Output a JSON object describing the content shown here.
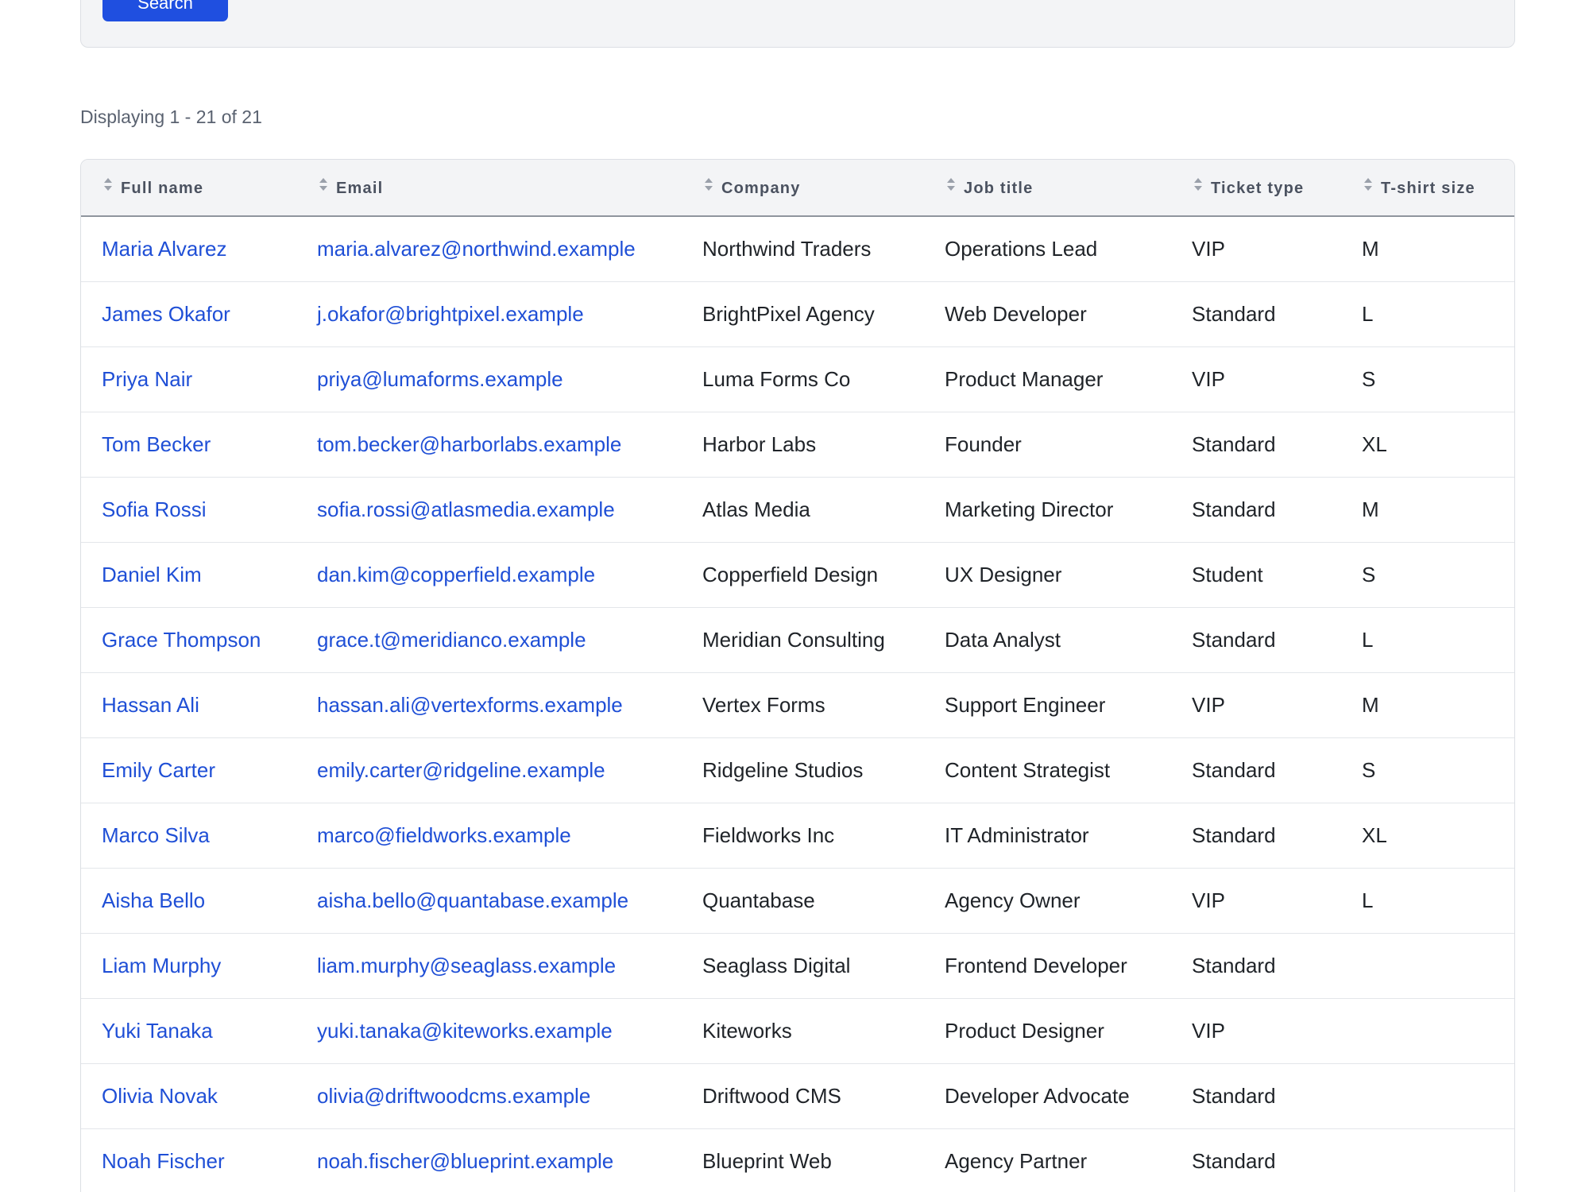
{
  "search": {
    "button_label": "Search"
  },
  "results": {
    "summary": "Displaying 1 - 21 of 21"
  },
  "table": {
    "columns": [
      "Full name",
      "Email",
      "Company",
      "Job title",
      "Ticket type",
      "T-shirt size"
    ],
    "rows": [
      [
        "Maria Alvarez",
        "maria.alvarez@northwind.example",
        "Northwind Traders",
        "Operations Lead",
        "VIP",
        "M"
      ],
      [
        "James Okafor",
        "j.okafor@brightpixel.example",
        "BrightPixel Agency",
        "Web Developer",
        "Standard",
        "L"
      ],
      [
        "Priya Nair",
        "priya@lumaforms.example",
        "Luma Forms Co",
        "Product Manager",
        "VIP",
        "S"
      ],
      [
        "Tom Becker",
        "tom.becker@harborlabs.example",
        "Harbor Labs",
        "Founder",
        "Standard",
        "XL"
      ],
      [
        "Sofia Rossi",
        "sofia.rossi@atlasmedia.example",
        "Atlas Media",
        "Marketing Director",
        "Standard",
        "M"
      ],
      [
        "Daniel Kim",
        "dan.kim@copperfield.example",
        "Copperfield Design",
        "UX Designer",
        "Student",
        "S"
      ],
      [
        "Grace Thompson",
        "grace.t@meridianco.example",
        "Meridian Consulting",
        "Data Analyst",
        "Standard",
        "L"
      ],
      [
        "Hassan Ali",
        "hassan.ali@vertexforms.example",
        "Vertex Forms",
        "Support Engineer",
        "VIP",
        "M"
      ],
      [
        "Emily Carter",
        "emily.carter@ridgeline.example",
        "Ridgeline Studios",
        "Content Strategist",
        "Standard",
        "S"
      ],
      [
        "Marco Silva",
        "marco@fieldworks.example",
        "Fieldworks Inc",
        "IT Administrator",
        "Standard",
        "XL"
      ],
      [
        "Aisha Bello",
        "aisha.bello@quantabase.example",
        "Quantabase",
        "Agency Owner",
        "VIP",
        "L"
      ],
      [
        "Liam Murphy",
        "liam.murphy@seaglass.example",
        "Seaglass Digital",
        "Frontend Developer",
        "Standard",
        ""
      ],
      [
        "Yuki Tanaka",
        "yuki.tanaka@kiteworks.example",
        "Kiteworks",
        "Product Designer",
        "VIP",
        ""
      ],
      [
        "Olivia Novak",
        "olivia@driftwoodcms.example",
        "Driftwood CMS",
        "Developer Advocate",
        "Standard",
        ""
      ],
      [
        "Noah Fischer",
        "noah.fischer@blueprint.example",
        "Blueprint Web",
        "Agency Partner",
        "Standard",
        ""
      ]
    ]
  }
}
